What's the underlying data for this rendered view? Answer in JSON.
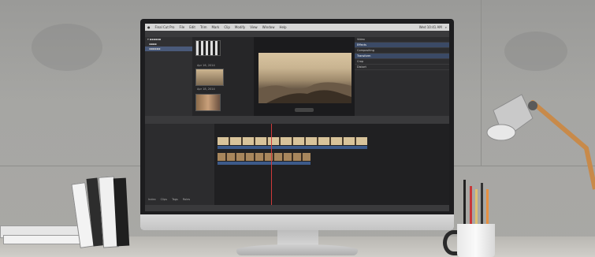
{
  "app": {
    "menu_items": [
      "Final Cut Pro",
      "File",
      "Edit",
      "Trim",
      "Mark",
      "Clip",
      "Modify",
      "View",
      "Window",
      "Help"
    ],
    "status_right": "Wed 10:41 AM",
    "browser_dates": [
      "Apr 16, 2014",
      "Apr 18, 2014"
    ],
    "timeline_tabs": [
      "Index",
      "Clips",
      "Tags",
      "Roles"
    ],
    "inspector_sections": [
      "Video",
      "Effects",
      "Compositing",
      "Transform",
      "Crop",
      "Distort"
    ]
  },
  "colors": {
    "wall": "#a6a6a3",
    "screen_bg": "#2a2a2c",
    "accent_blue": "#3b4a66",
    "playhead": "#d03a3a"
  }
}
